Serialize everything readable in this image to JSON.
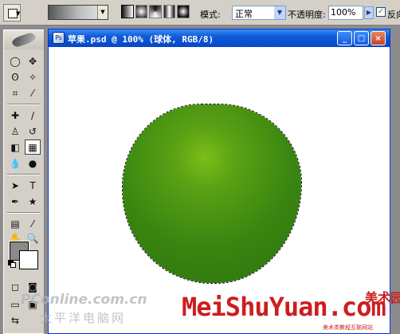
{
  "options_bar": {
    "mode_label": "模式:",
    "mode_value": "正常",
    "opacity_label": "不透明度:",
    "opacity_value": "100%",
    "reverse_label": "反向"
  },
  "document": {
    "title": "苹果.psd @ 100% (球体, RGB/8)",
    "min_glyph": "_",
    "max_glyph": "□",
    "close_glyph": "×"
  },
  "colors": {
    "foreground": "#8a8a8a",
    "background": "#ffffff",
    "apple_light": "#7cbe18",
    "apple_dark": "#2c720d"
  },
  "watermarks": {
    "pconline": "PConline.com.cn",
    "pconline_cn": "太平洋电脑网",
    "meishu": "MeiShuYuan.com",
    "meishu_cn": "美术园",
    "tagline": "美术类教程互联网站"
  }
}
